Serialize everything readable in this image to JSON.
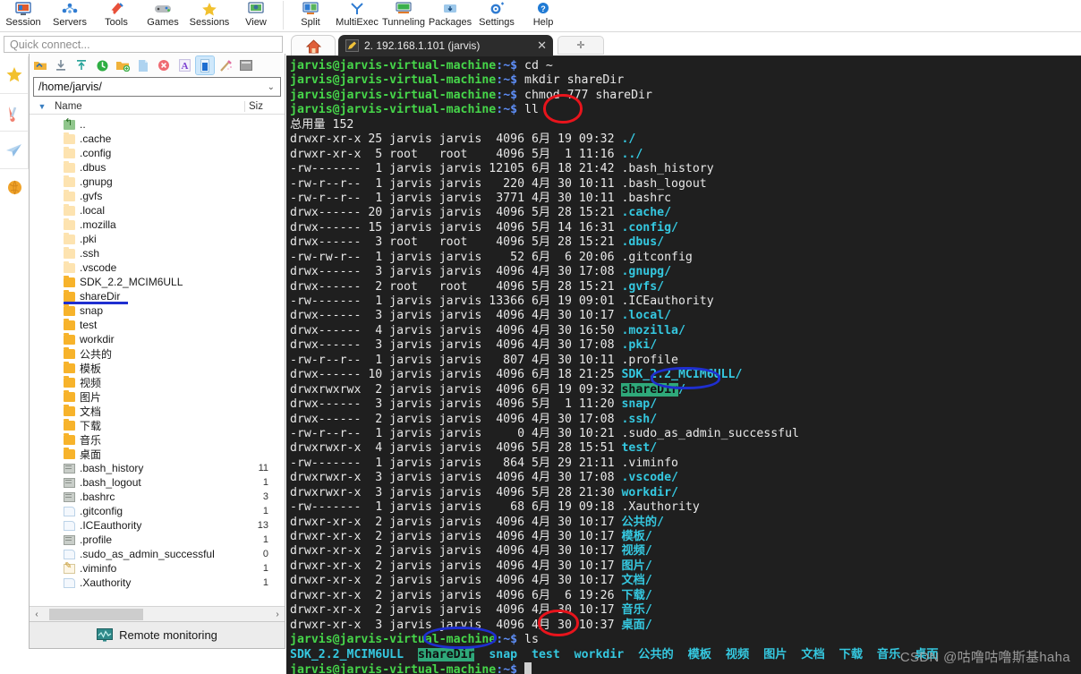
{
  "ribbon": {
    "items": [
      {
        "label": "Session",
        "icon": "session-icon"
      },
      {
        "label": "Servers",
        "icon": "servers-icon"
      },
      {
        "label": "Tools",
        "icon": "tools-icon"
      },
      {
        "label": "Games",
        "icon": "games-icon"
      },
      {
        "label": "Sessions",
        "icon": "sessions-star-icon"
      },
      {
        "label": "View",
        "icon": "view-icon"
      },
      {
        "label": "Split",
        "icon": "split-icon"
      },
      {
        "label": "MultiExec",
        "icon": "multiexec-icon"
      },
      {
        "label": "Tunneling",
        "icon": "tunneling-icon"
      },
      {
        "label": "Packages",
        "icon": "packages-icon"
      },
      {
        "label": "Settings",
        "icon": "settings-gear-icon"
      },
      {
        "label": "Help",
        "icon": "help-icon"
      }
    ]
  },
  "quick_connect": {
    "placeholder": "Quick connect..."
  },
  "rail": {
    "buttons": [
      {
        "name": "favorites",
        "icon": "star-icon"
      },
      {
        "name": "tools",
        "icon": "swiss-knife-icon"
      },
      {
        "name": "send",
        "icon": "paper-plane-icon"
      },
      {
        "name": "globe",
        "icon": "globe-icon"
      }
    ]
  },
  "file_browser": {
    "tools": [
      {
        "name": "go-up",
        "icon": "folder-up-icon"
      },
      {
        "name": "download",
        "icon": "download-icon"
      },
      {
        "name": "upload",
        "icon": "upload-icon"
      },
      {
        "name": "refresh",
        "icon": "refresh-icon"
      },
      {
        "name": "new-folder",
        "icon": "new-folder-icon"
      },
      {
        "name": "new-file",
        "icon": "new-file-icon"
      },
      {
        "name": "delete",
        "icon": "delete-icon"
      },
      {
        "name": "text-mode",
        "icon": "font-a-icon"
      },
      {
        "name": "binary-mode",
        "icon": "binary-icon"
      },
      {
        "name": "permissions",
        "icon": "magic-wand-icon"
      },
      {
        "name": "terminal",
        "icon": "terminal-icon"
      }
    ],
    "path": "/home/jarvis/",
    "columns": {
      "name": "Name",
      "size": "Siz"
    },
    "rows": [
      {
        "name": "..",
        "icon": "parent-dir-icon",
        "size": ""
      },
      {
        "name": ".cache",
        "icon": "folder-light-icon",
        "size": ""
      },
      {
        "name": ".config",
        "icon": "folder-light-icon",
        "size": ""
      },
      {
        "name": ".dbus",
        "icon": "folder-light-icon",
        "size": ""
      },
      {
        "name": ".gnupg",
        "icon": "folder-light-icon",
        "size": ""
      },
      {
        "name": ".gvfs",
        "icon": "folder-light-icon",
        "size": ""
      },
      {
        "name": ".local",
        "icon": "folder-light-icon",
        "size": ""
      },
      {
        "name": ".mozilla",
        "icon": "folder-light-icon",
        "size": ""
      },
      {
        "name": ".pki",
        "icon": "folder-light-icon",
        "size": ""
      },
      {
        "name": ".ssh",
        "icon": "folder-light-icon",
        "size": ""
      },
      {
        "name": ".vscode",
        "icon": "folder-light-icon",
        "size": ""
      },
      {
        "name": "SDK_2.2_MCIM6ULL",
        "icon": "folder-icon",
        "size": ""
      },
      {
        "name": "shareDir",
        "icon": "folder-icon",
        "size": "",
        "highlight_underline": true
      },
      {
        "name": "snap",
        "icon": "folder-icon",
        "size": ""
      },
      {
        "name": "test",
        "icon": "folder-icon",
        "size": ""
      },
      {
        "name": "workdir",
        "icon": "folder-icon",
        "size": ""
      },
      {
        "name": "公共的",
        "icon": "folder-icon",
        "size": ""
      },
      {
        "name": "模板",
        "icon": "folder-icon",
        "size": ""
      },
      {
        "name": "视频",
        "icon": "folder-icon",
        "size": ""
      },
      {
        "name": "图片",
        "icon": "folder-icon",
        "size": ""
      },
      {
        "name": "文档",
        "icon": "folder-icon",
        "size": ""
      },
      {
        "name": "下载",
        "icon": "folder-icon",
        "size": ""
      },
      {
        "name": "音乐",
        "icon": "folder-icon",
        "size": ""
      },
      {
        "name": "桌面",
        "icon": "folder-icon",
        "size": ""
      },
      {
        "name": ".bash_history",
        "icon": "shell-file-icon",
        "size": "11"
      },
      {
        "name": ".bash_logout",
        "icon": "shell-file-icon",
        "size": "1"
      },
      {
        "name": ".bashrc",
        "icon": "shell-file-icon",
        "size": "3"
      },
      {
        "name": ".gitconfig",
        "icon": "text-file-icon",
        "size": "1"
      },
      {
        "name": ".ICEauthority",
        "icon": "text-file-icon",
        "size": "13"
      },
      {
        "name": ".profile",
        "icon": "shell-file-icon",
        "size": "1"
      },
      {
        "name": ".sudo_as_admin_successful",
        "icon": "text-file-icon",
        "size": "0"
      },
      {
        "name": ".viminfo",
        "icon": "edit-file-icon",
        "size": "1"
      },
      {
        "name": ".Xauthority",
        "icon": "text-file-icon",
        "size": "1"
      }
    ],
    "scroll": {
      "left_arrow": "‹",
      "right_arrow": "›"
    },
    "status": {
      "label": "Remote monitoring",
      "icon": "monitor-graph-icon"
    }
  },
  "tabs": {
    "home_icon": "home-icon",
    "active": {
      "icon": "pencil-tab-icon",
      "label": "2. 192.168.1.101 (jarvis)",
      "close": "✕"
    },
    "new_tab": {
      "icon": "plus-icon",
      "label": "✛"
    }
  },
  "terminal": {
    "prompt_user": "jarvis@jarvis-virtual-machine",
    "prompt_path": ":~$",
    "lines": [
      {
        "type": "prompt",
        "cmd": " cd ~"
      },
      {
        "type": "prompt",
        "cmd": " mkdir shareDir"
      },
      {
        "type": "prompt",
        "cmd": " chmod 777 shareDir"
      },
      {
        "type": "prompt",
        "cmd": " ll"
      },
      {
        "type": "plain",
        "text": "总用量 152"
      },
      {
        "type": "ls",
        "perm": "drwxr-xr-x",
        "links": "25",
        "owner": "jarvis",
        "group": "jarvis",
        "size": "4096",
        "month": "6月",
        "day": "19",
        "time": "09:32",
        "name": "./",
        "dir": true
      },
      {
        "type": "ls",
        "perm": "drwxr-xr-x",
        "links": " 5",
        "owner": "root",
        "group": "root",
        "size": "4096",
        "month": "5月",
        "day": " 1",
        "time": "11:16",
        "name": "../",
        "dir": true
      },
      {
        "type": "ls",
        "perm": "-rw-------",
        "links": " 1",
        "owner": "jarvis",
        "group": "jarvis",
        "size": "12105",
        "month": "6月",
        "day": "18",
        "time": "21:42",
        "name": ".bash_history",
        "dir": false
      },
      {
        "type": "ls",
        "perm": "-rw-r--r--",
        "links": " 1",
        "owner": "jarvis",
        "group": "jarvis",
        "size": "220",
        "month": "4月",
        "day": "30",
        "time": "10:11",
        "name": ".bash_logout",
        "dir": false
      },
      {
        "type": "ls",
        "perm": "-rw-r--r--",
        "links": " 1",
        "owner": "jarvis",
        "group": "jarvis",
        "size": "3771",
        "month": "4月",
        "day": "30",
        "time": "10:11",
        "name": ".bashrc",
        "dir": false
      },
      {
        "type": "ls",
        "perm": "drwx------",
        "links": "20",
        "owner": "jarvis",
        "group": "jarvis",
        "size": "4096",
        "month": "5月",
        "day": "28",
        "time": "15:21",
        "name": ".cache/",
        "dir": true
      },
      {
        "type": "ls",
        "perm": "drwx------",
        "links": "15",
        "owner": "jarvis",
        "group": "jarvis",
        "size": "4096",
        "month": "5月",
        "day": "14",
        "time": "16:31",
        "name": ".config/",
        "dir": true
      },
      {
        "type": "ls",
        "perm": "drwx------",
        "links": " 3",
        "owner": "root",
        "group": "root",
        "size": "4096",
        "month": "5月",
        "day": "28",
        "time": "15:21",
        "name": ".dbus/",
        "dir": true
      },
      {
        "type": "ls",
        "perm": "-rw-rw-r--",
        "links": " 1",
        "owner": "jarvis",
        "group": "jarvis",
        "size": "52",
        "month": "6月",
        "day": " 6",
        "time": "20:06",
        "name": ".gitconfig",
        "dir": false
      },
      {
        "type": "ls",
        "perm": "drwx------",
        "links": " 3",
        "owner": "jarvis",
        "group": "jarvis",
        "size": "4096",
        "month": "4月",
        "day": "30",
        "time": "17:08",
        "name": ".gnupg/",
        "dir": true
      },
      {
        "type": "ls",
        "perm": "drwx------",
        "links": " 2",
        "owner": "root",
        "group": "root",
        "size": "4096",
        "month": "5月",
        "day": "28",
        "time": "15:21",
        "name": ".gvfs/",
        "dir": true
      },
      {
        "type": "ls",
        "perm": "-rw-------",
        "links": " 1",
        "owner": "jarvis",
        "group": "jarvis",
        "size": "13366",
        "month": "6月",
        "day": "19",
        "time": "09:01",
        "name": ".ICEauthority",
        "dir": false
      },
      {
        "type": "ls",
        "perm": "drwx------",
        "links": " 3",
        "owner": "jarvis",
        "group": "jarvis",
        "size": "4096",
        "month": "4月",
        "day": "30",
        "time": "10:17",
        "name": ".local/",
        "dir": true
      },
      {
        "type": "ls",
        "perm": "drwx------",
        "links": " 4",
        "owner": "jarvis",
        "group": "jarvis",
        "size": "4096",
        "month": "4月",
        "day": "30",
        "time": "16:50",
        "name": ".mozilla/",
        "dir": true
      },
      {
        "type": "ls",
        "perm": "drwx------",
        "links": " 3",
        "owner": "jarvis",
        "group": "jarvis",
        "size": "4096",
        "month": "4月",
        "day": "30",
        "time": "17:08",
        "name": ".pki/",
        "dir": true
      },
      {
        "type": "ls",
        "perm": "-rw-r--r--",
        "links": " 1",
        "owner": "jarvis",
        "group": "jarvis",
        "size": "807",
        "month": "4月",
        "day": "30",
        "time": "10:11",
        "name": ".profile",
        "dir": false
      },
      {
        "type": "ls",
        "perm": "drwx------",
        "links": "10",
        "owner": "jarvis",
        "group": "jarvis",
        "size": "4096",
        "month": "6月",
        "day": "18",
        "time": "21:25",
        "name": "SDK_2.2_MCIM6ULL/",
        "dir": true
      },
      {
        "type": "ls",
        "perm": "drwxrwxrwx",
        "links": " 2",
        "owner": "jarvis",
        "group": "jarvis",
        "size": "4096",
        "month": "6月",
        "day": "19",
        "time": "09:32",
        "name": "shareDir/",
        "dir": true,
        "highlight": "shareDir"
      },
      {
        "type": "ls",
        "perm": "drwx------",
        "links": " 3",
        "owner": "jarvis",
        "group": "jarvis",
        "size": "4096",
        "month": "5月",
        "day": " 1",
        "time": "11:20",
        "name": "snap/",
        "dir": true
      },
      {
        "type": "ls",
        "perm": "drwx------",
        "links": " 2",
        "owner": "jarvis",
        "group": "jarvis",
        "size": "4096",
        "month": "4月",
        "day": "30",
        "time": "17:08",
        "name": ".ssh/",
        "dir": true
      },
      {
        "type": "ls",
        "perm": "-rw-r--r--",
        "links": " 1",
        "owner": "jarvis",
        "group": "jarvis",
        "size": "0",
        "month": "4月",
        "day": "30",
        "time": "10:21",
        "name": ".sudo_as_admin_successful",
        "dir": false
      },
      {
        "type": "ls",
        "perm": "drwxrwxr-x",
        "links": " 4",
        "owner": "jarvis",
        "group": "jarvis",
        "size": "4096",
        "month": "5月",
        "day": "28",
        "time": "15:51",
        "name": "test/",
        "dir": true
      },
      {
        "type": "ls",
        "perm": "-rw-------",
        "links": " 1",
        "owner": "jarvis",
        "group": "jarvis",
        "size": "864",
        "month": "5月",
        "day": "29",
        "time": "21:11",
        "name": ".viminfo",
        "dir": false
      },
      {
        "type": "ls",
        "perm": "drwxrwxr-x",
        "links": " 3",
        "owner": "jarvis",
        "group": "jarvis",
        "size": "4096",
        "month": "4月",
        "day": "30",
        "time": "17:08",
        "name": ".vscode/",
        "dir": true
      },
      {
        "type": "ls",
        "perm": "drwxrwxr-x",
        "links": " 3",
        "owner": "jarvis",
        "group": "jarvis",
        "size": "4096",
        "month": "5月",
        "day": "28",
        "time": "21:30",
        "name": "workdir/",
        "dir": true
      },
      {
        "type": "ls",
        "perm": "-rw-------",
        "links": " 1",
        "owner": "jarvis",
        "group": "jarvis",
        "size": "68",
        "month": "6月",
        "day": "19",
        "time": "09:18",
        "name": ".Xauthority",
        "dir": false
      },
      {
        "type": "ls",
        "perm": "drwxr-xr-x",
        "links": " 2",
        "owner": "jarvis",
        "group": "jarvis",
        "size": "4096",
        "month": "4月",
        "day": "30",
        "time": "10:17",
        "name": "公共的/",
        "dir": true
      },
      {
        "type": "ls",
        "perm": "drwxr-xr-x",
        "links": " 2",
        "owner": "jarvis",
        "group": "jarvis",
        "size": "4096",
        "month": "4月",
        "day": "30",
        "time": "10:17",
        "name": "模板/",
        "dir": true
      },
      {
        "type": "ls",
        "perm": "drwxr-xr-x",
        "links": " 2",
        "owner": "jarvis",
        "group": "jarvis",
        "size": "4096",
        "month": "4月",
        "day": "30",
        "time": "10:17",
        "name": "视频/",
        "dir": true
      },
      {
        "type": "ls",
        "perm": "drwxr-xr-x",
        "links": " 2",
        "owner": "jarvis",
        "group": "jarvis",
        "size": "4096",
        "month": "4月",
        "day": "30",
        "time": "10:17",
        "name": "图片/",
        "dir": true
      },
      {
        "type": "ls",
        "perm": "drwxr-xr-x",
        "links": " 2",
        "owner": "jarvis",
        "group": "jarvis",
        "size": "4096",
        "month": "4月",
        "day": "30",
        "time": "10:17",
        "name": "文档/",
        "dir": true
      },
      {
        "type": "ls",
        "perm": "drwxr-xr-x",
        "links": " 2",
        "owner": "jarvis",
        "group": "jarvis",
        "size": "4096",
        "month": "6月",
        "day": " 6",
        "time": "19:26",
        "name": "下载/",
        "dir": true
      },
      {
        "type": "ls",
        "perm": "drwxr-xr-x",
        "links": " 2",
        "owner": "jarvis",
        "group": "jarvis",
        "size": "4096",
        "month": "4月",
        "day": "30",
        "time": "10:17",
        "name": "音乐/",
        "dir": true
      },
      {
        "type": "ls",
        "perm": "drwxr-xr-x",
        "links": " 3",
        "owner": "jarvis",
        "group": "jarvis",
        "size": "4096",
        "month": "4月",
        "day": "30",
        "time": "10:37",
        "name": "桌面/",
        "dir": true
      },
      {
        "type": "prompt",
        "cmd": " ls"
      },
      {
        "type": "lsrow",
        "names": [
          "SDK_2.2_MCIM6ULL",
          "shareDir",
          "snap",
          "test",
          "workdir",
          "公共的",
          "模板",
          "视频",
          "图片",
          "文档",
          "下载",
          "音乐",
          "桌面"
        ],
        "highlight": "shareDir"
      },
      {
        "type": "prompt",
        "cmd": " ",
        "cursor": true
      }
    ],
    "watermark": "CSDN @咕噜咕噜斯基haha"
  },
  "annotations": {
    "colors": {
      "red": "#e8141c",
      "blue": "#1f2fd0",
      "green_highlight": "#2fa97a"
    },
    "marks": [
      {
        "name": "circle-ll-command",
        "shape": "ellipse",
        "color": "#e8141c"
      },
      {
        "name": "circle-sharedir-listing",
        "shape": "ellipse",
        "color": "#1f2fd0"
      },
      {
        "name": "circle-ls-command",
        "shape": "ellipse",
        "color": "#e8141c"
      },
      {
        "name": "circle-sharedir-ls",
        "shape": "ellipse",
        "color": "#1f2fd0"
      },
      {
        "name": "underline-sharedir-filelist",
        "shape": "underline",
        "color": "#1f2fd0"
      }
    ]
  }
}
